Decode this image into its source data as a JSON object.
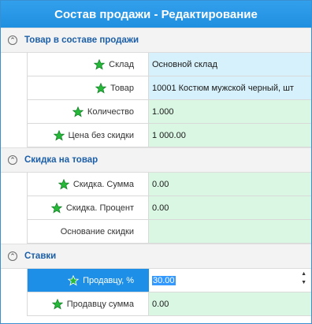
{
  "title": "Состав продажи - Редактирование",
  "sections": [
    {
      "title": "Товар в составе продажи",
      "rows": [
        {
          "label": "Склад",
          "value": "Основной склад",
          "required": true
        },
        {
          "label": "Товар",
          "value": "10001 Костюм мужской черный, шт",
          "required": true
        },
        {
          "label": "Количество",
          "value": "1.000",
          "required": true
        },
        {
          "label": "Цена без скидки",
          "value": "1 000.00",
          "required": true
        }
      ]
    },
    {
      "title": "Скидка на товар",
      "rows": [
        {
          "label": "Скидка. Сумма",
          "value": "0.00",
          "required": true
        },
        {
          "label": "Скидка. Процент",
          "value": "0.00",
          "required": true
        },
        {
          "label": "Основание скидки",
          "value": "",
          "required": false
        }
      ]
    },
    {
      "title": "Ставки",
      "rows": [
        {
          "label": "Продавцу, %",
          "value": "30.00",
          "required": true
        },
        {
          "label": "Продавцу сумма",
          "value": "0.00",
          "required": true
        }
      ]
    }
  ],
  "icons": {
    "collapse": "collapse-up-icon",
    "required": "green-star-icon"
  },
  "colors": {
    "title_bg": "#1f8fdf",
    "section_title": "#1c5fa8",
    "value_blue": "#d6f1fb",
    "value_green": "#d9f7e2",
    "selected": "#1e8fe6"
  }
}
